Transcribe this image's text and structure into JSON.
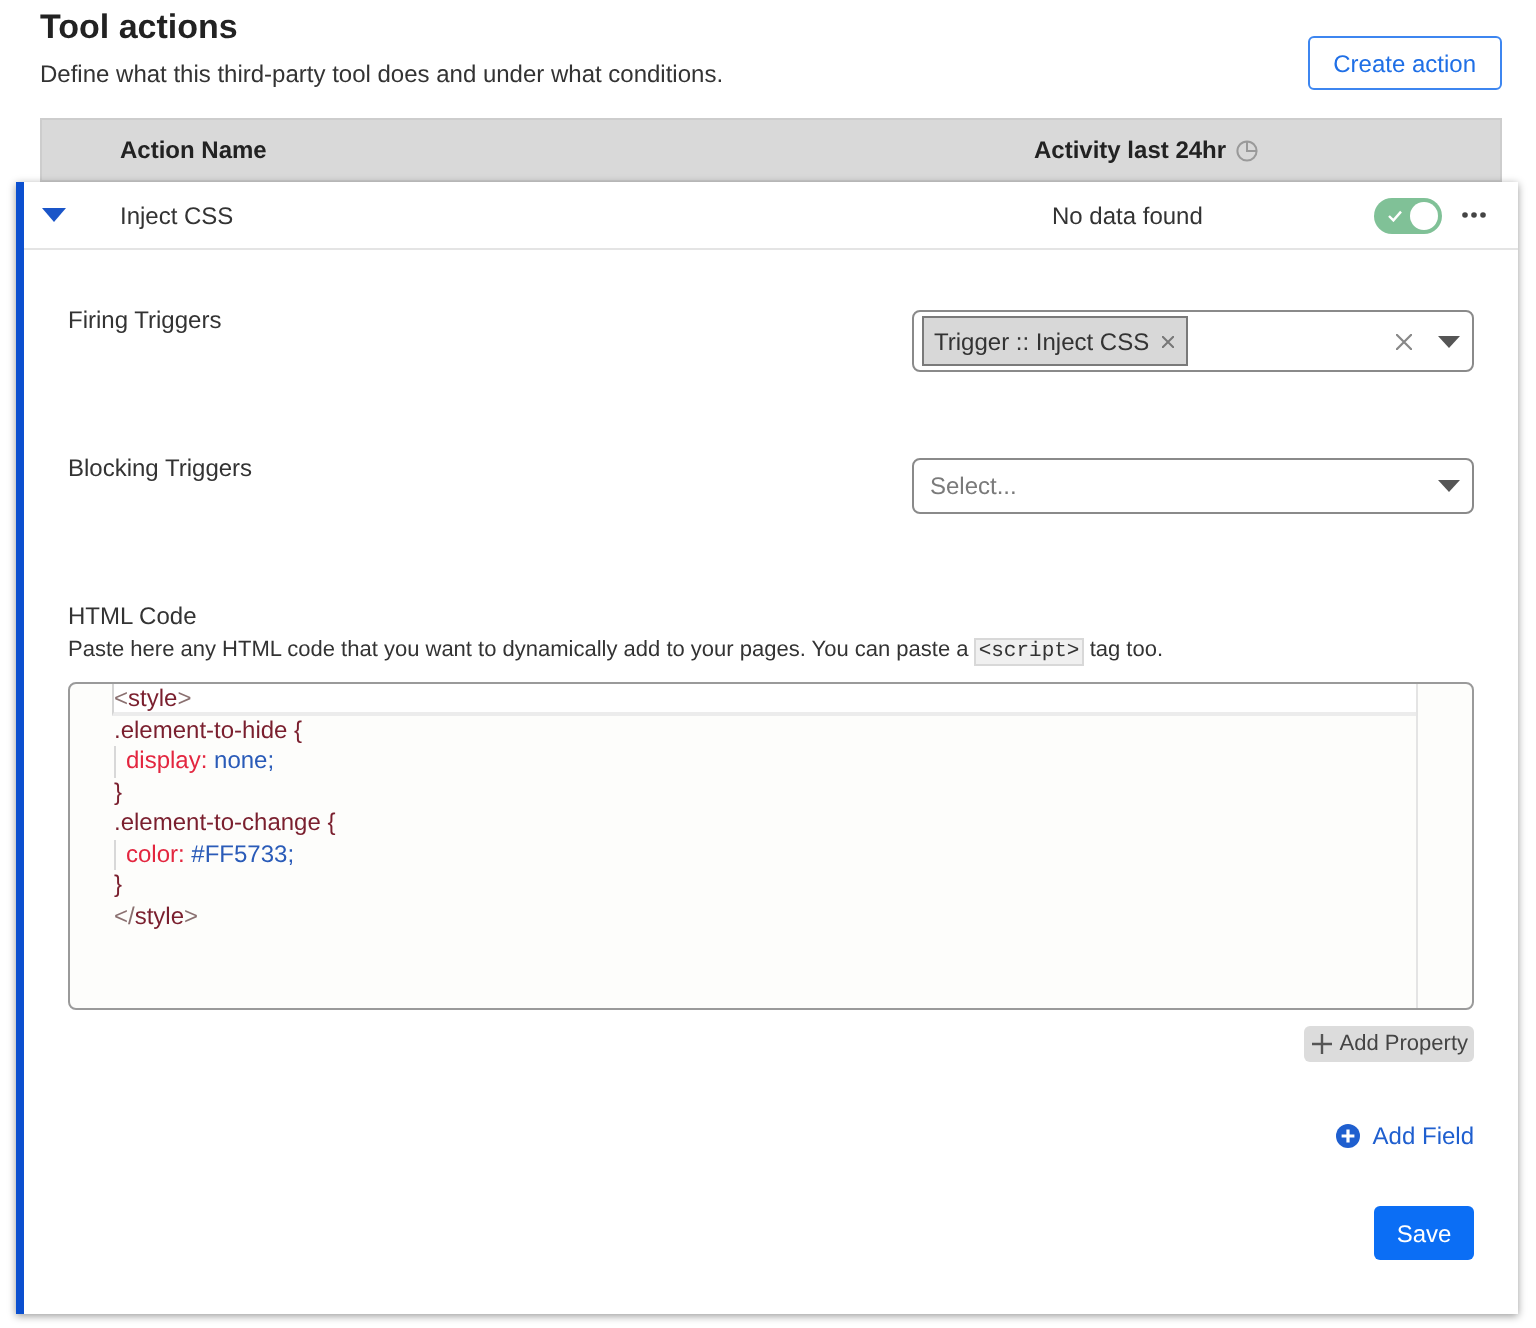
{
  "header": {
    "title": "Tool actions",
    "subtitle": "Define what this third-party tool does and under what conditions.",
    "create_button": "Create action"
  },
  "table": {
    "columns": [
      {
        "label": "Action Name"
      },
      {
        "label": "Activity last 24hr"
      }
    ],
    "rows": [
      {
        "name": "Inject CSS",
        "activity": "No data found",
        "expanded": true,
        "enabled": true,
        "form": {
          "fields": [
            {
              "kind": "multiselect",
              "label": "Firing Triggers",
              "chips": [
                {
                  "label": "Trigger :: Inject CSS"
                }
              ]
            },
            {
              "kind": "select",
              "label": "Blocking Triggers",
              "placeholder": "Select..."
            },
            {
              "kind": "code",
              "label": "HTML Code",
              "description": [
                {
                  "kind": "text",
                  "text": "Paste here any HTML code that you want to dynamically add to your pages. You can paste a"
                },
                {
                  "kind": "code",
                  "text": "<script>"
                },
                {
                  "kind": "text",
                  "text": "tag too."
                }
              ],
              "lines": [
                {
                  "active": true,
                  "indented": false,
                  "tokens": [
                    {
                      "kind": "bracket",
                      "text": "<"
                    },
                    {
                      "kind": "tag",
                      "text": "style"
                    },
                    {
                      "kind": "bracket",
                      "text": ">"
                    }
                  ]
                },
                {
                  "active": false,
                  "indented": false,
                  "tokens": [
                    {
                      "kind": "selector",
                      "text": ".element-to-hide {"
                    }
                  ]
                },
                {
                  "active": false,
                  "indented": true,
                  "tokens": [
                    {
                      "kind": "property",
                      "text": "display:"
                    },
                    {
                      "kind": "value",
                      "text": " none;"
                    }
                  ]
                },
                {
                  "active": false,
                  "indented": false,
                  "tokens": [
                    {
                      "kind": "selector",
                      "text": "}"
                    }
                  ]
                },
                {
                  "active": false,
                  "indented": false,
                  "tokens": [
                    {
                      "kind": "selector",
                      "text": ".element-to-change {"
                    }
                  ]
                },
                {
                  "active": false,
                  "indented": true,
                  "tokens": [
                    {
                      "kind": "property",
                      "text": "color:"
                    },
                    {
                      "kind": "value",
                      "text": " #FF5733;"
                    }
                  ]
                },
                {
                  "active": false,
                  "indented": false,
                  "tokens": [
                    {
                      "kind": "selector",
                      "text": "}"
                    }
                  ]
                },
                {
                  "active": false,
                  "indented": false,
                  "tokens": [
                    {
                      "kind": "bracket",
                      "text": "</"
                    },
                    {
                      "kind": "tag",
                      "text": "style"
                    },
                    {
                      "kind": "bracket",
                      "text": ">"
                    }
                  ]
                }
              ],
              "add_button": "Add Property"
            }
          ],
          "add_field": "Add Field",
          "save": "Save"
        }
      }
    ]
  }
}
